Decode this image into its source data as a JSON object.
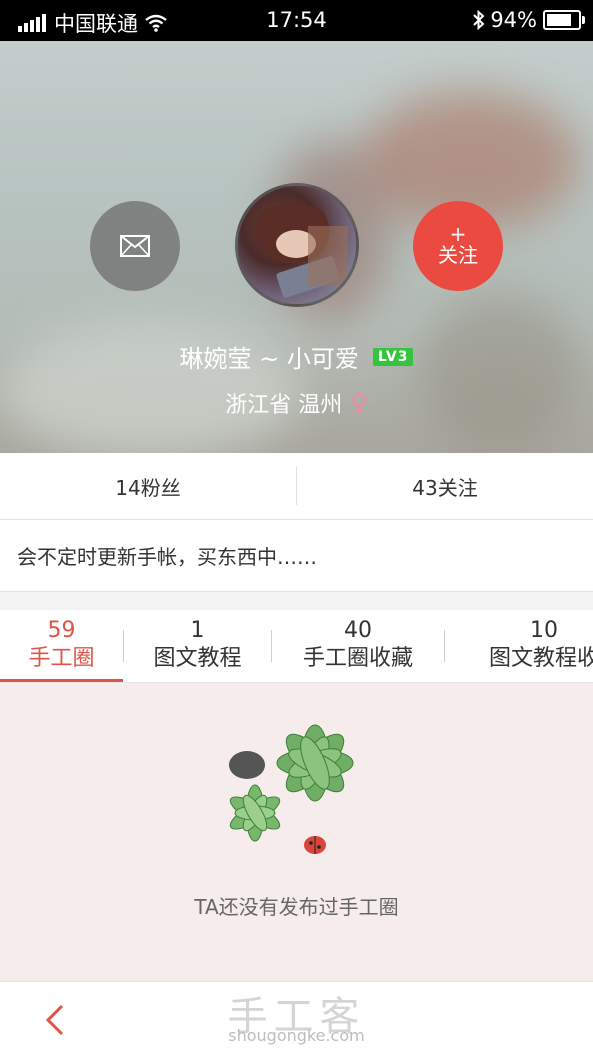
{
  "status_bar": {
    "carrier": "中国联通",
    "time": "17:54",
    "battery": "94%",
    "battery_level": 0.94
  },
  "profile": {
    "name": "琳婉莹 ~ 小可爱",
    "level": "LV3",
    "location": "浙江省 温州",
    "gender_symbol": "♀",
    "follow_plus": "+",
    "follow_label": "关注"
  },
  "stats": {
    "fans": "14粉丝",
    "following": "43关注"
  },
  "bio": "会不定时更新手帐，买东西中……",
  "tabs": [
    {
      "count": "59",
      "label": "手工圈"
    },
    {
      "count": "1",
      "label": "图文教程"
    },
    {
      "count": "40",
      "label": "手工圈收藏"
    },
    {
      "count": "10",
      "label": "图文教程收"
    }
  ],
  "empty_state": {
    "text": "TA还没有发布过手工圈"
  },
  "bottom": {
    "watermark_cn": "手工客",
    "watermark_en": "shougongke.com"
  },
  "colors": {
    "accent": "#e05347",
    "follow_button": "#ea4a3f",
    "level_badge": "#35c43d",
    "empty_bg": "#f5eceb"
  }
}
